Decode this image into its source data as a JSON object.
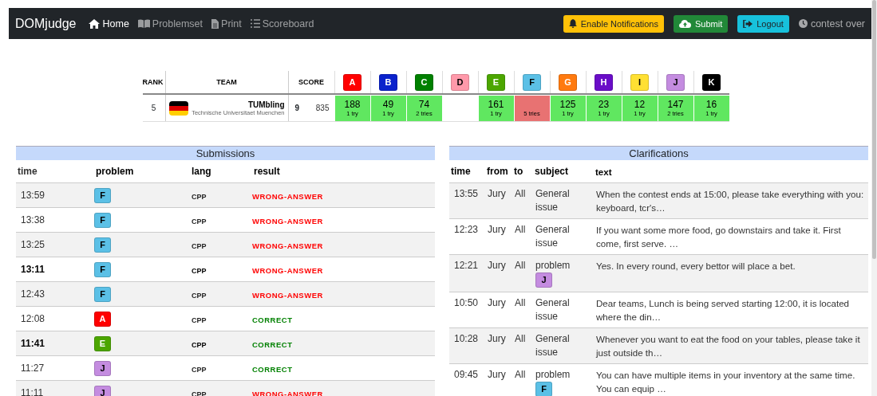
{
  "navbar": {
    "brand": "DOMjudge",
    "links": [
      {
        "label": "Home",
        "selected": true
      },
      {
        "label": "Problemset",
        "selected": false
      },
      {
        "label": "Print",
        "selected": false
      },
      {
        "label": "Scoreboard",
        "selected": false
      }
    ],
    "buttons": [
      {
        "label": "Enable Notifications",
        "kind": "notify"
      },
      {
        "label": "Submit",
        "kind": "submit"
      },
      {
        "label": "Logout",
        "kind": "logout"
      }
    ],
    "status": "contest over"
  },
  "scoreboard": {
    "columns": {
      "rank": "RANK",
      "team": "TEAM",
      "score": "SCORE"
    },
    "problems": [
      {
        "letter": "A",
        "color": "#ff0000"
      },
      {
        "letter": "B",
        "color": "#0a22cc"
      },
      {
        "letter": "C",
        "color": "#008000"
      },
      {
        "letter": "D",
        "color": "#ff99aa"
      },
      {
        "letter": "E",
        "color": "#4ca600"
      },
      {
        "letter": "F",
        "color": "#5bc0e6"
      },
      {
        "letter": "G",
        "color": "#ff7a0f"
      },
      {
        "letter": "H",
        "color": "#6a0dc8"
      },
      {
        "letter": "I",
        "color": "#ffe033"
      },
      {
        "letter": "J",
        "color": "#c48ce0"
      },
      {
        "letter": "K",
        "color": "#000000"
      }
    ],
    "row": {
      "rank": "5",
      "team": "TUMbling",
      "affiliation": "Technische Universitaet Muenchen",
      "solved": "9",
      "penalty": "835",
      "cells": [
        {
          "kind": "solved",
          "time": "188",
          "tries": "1 try"
        },
        {
          "kind": "solved",
          "time": "49",
          "tries": "1 try"
        },
        {
          "kind": "solved",
          "time": "74",
          "tries": "2 tries"
        },
        {
          "kind": "none"
        },
        {
          "kind": "solved",
          "time": "161",
          "tries": "1 try"
        },
        {
          "kind": "failed",
          "tries": "5 tries"
        },
        {
          "kind": "solved",
          "time": "125",
          "tries": "1 try"
        },
        {
          "kind": "solved",
          "time": "23",
          "tries": "1 try"
        },
        {
          "kind": "solved",
          "time": "12",
          "tries": "1 try"
        },
        {
          "kind": "solved",
          "time": "147",
          "tries": "2 tries"
        },
        {
          "kind": "solved",
          "time": "16",
          "tries": "1 try"
        }
      ]
    }
  },
  "submissions": {
    "title": "Submissions",
    "columns": [
      "time",
      "problem",
      "lang",
      "result"
    ],
    "rows": [
      {
        "time": "13:59",
        "problem": "F",
        "color": "#5bc0e6",
        "lang": "CPP",
        "result": "WRONG-ANSWER",
        "kind": "wrong",
        "unread": false
      },
      {
        "time": "13:38",
        "problem": "F",
        "color": "#5bc0e6",
        "lang": "CPP",
        "result": "WRONG-ANSWER",
        "kind": "wrong",
        "unread": false
      },
      {
        "time": "13:25",
        "problem": "F",
        "color": "#5bc0e6",
        "lang": "CPP",
        "result": "WRONG-ANSWER",
        "kind": "wrong",
        "unread": false
      },
      {
        "time": "13:11",
        "problem": "F",
        "color": "#5bc0e6",
        "lang": "CPP",
        "result": "WRONG-ANSWER",
        "kind": "wrong",
        "unread": true
      },
      {
        "time": "12:43",
        "problem": "F",
        "color": "#5bc0e6",
        "lang": "CPP",
        "result": "WRONG-ANSWER",
        "kind": "wrong",
        "unread": false
      },
      {
        "time": "12:08",
        "problem": "A",
        "color": "#ff0000",
        "lang": "CPP",
        "result": "CORRECT",
        "kind": "correct",
        "unread": false
      },
      {
        "time": "11:41",
        "problem": "E",
        "color": "#4ca600",
        "lang": "CPP",
        "result": "CORRECT",
        "kind": "correct",
        "unread": true
      },
      {
        "time": "11:27",
        "problem": "J",
        "color": "#c48ce0",
        "lang": "CPP",
        "result": "CORRECT",
        "kind": "correct",
        "unread": false
      },
      {
        "time": "11:11",
        "problem": "J",
        "color": "#c48ce0",
        "lang": "CPP",
        "result": "WRONG-ANSWER",
        "kind": "wrong",
        "unread": false
      }
    ]
  },
  "clarifications": {
    "title": "Clarifications",
    "columns": [
      "time",
      "from",
      "to",
      "subject",
      "text"
    ],
    "rows": [
      {
        "time": "13:55",
        "from": "Jury",
        "to": "All",
        "subject": "General issue",
        "kind": "general",
        "text": "When the contest ends at 15:00, please take everything with you: keyboard, tcr's…"
      },
      {
        "time": "12:23",
        "from": "Jury",
        "to": "All",
        "subject": "General issue",
        "kind": "general",
        "text": "If you want some more food, go downstairs and take it. First come, first serve. …"
      },
      {
        "time": "12:21",
        "from": "Jury",
        "to": "All",
        "subject": "problem",
        "kind": "problem",
        "problem": "J",
        "color": "#c48ce0",
        "text": "Yes. In every round, every bettor will place a bet."
      },
      {
        "time": "10:50",
        "from": "Jury",
        "to": "All",
        "subject": "General issue",
        "kind": "general",
        "text": "Dear teams, Lunch is being served starting 12:00, it is located where the din…"
      },
      {
        "time": "10:28",
        "from": "Jury",
        "to": "All",
        "subject": "General issue",
        "kind": "general",
        "text": "Whenever you want to eat the food on your tables, please take it just outside th…"
      },
      {
        "time": "09:45",
        "from": "Jury",
        "to": "All",
        "subject": "problem",
        "kind": "problem",
        "problem": "F",
        "color": "#5bc0e6",
        "text": "You can have multiple items in your inventory at the same time. You can equip …"
      }
    ]
  }
}
